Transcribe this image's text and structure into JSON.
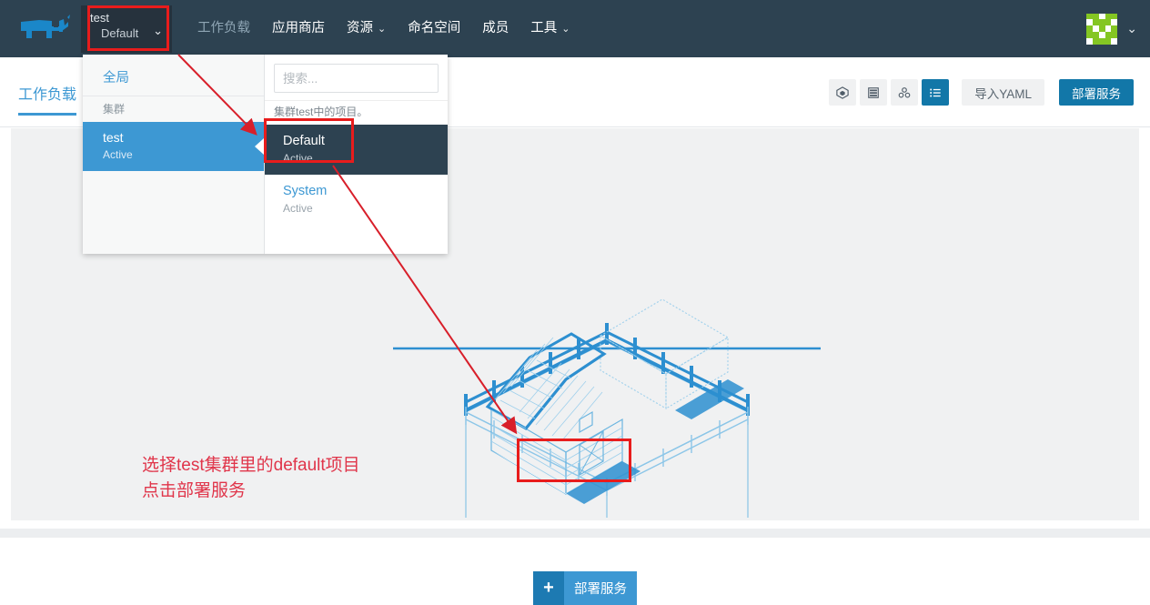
{
  "topnav": {
    "logo_icon": "rancher-bull-logo",
    "cluster_selector": {
      "cluster": "test",
      "project": "Default",
      "caret_icon": "chevron-down-icon"
    },
    "links": [
      {
        "label": "工作负载",
        "active": true,
        "caret": ""
      },
      {
        "label": "应用商店",
        "active": false,
        "caret": ""
      },
      {
        "label": "资源",
        "active": false,
        "caret": "⌄"
      },
      {
        "label": "命名空间",
        "active": false,
        "caret": ""
      },
      {
        "label": "成员",
        "active": false,
        "caret": ""
      },
      {
        "label": "工具",
        "active": false,
        "caret": "⌄"
      }
    ],
    "avatar_icon": "user-identicon-avatar",
    "avatar_caret_icon": "chevron-down-icon"
  },
  "subbar": {
    "tab_label": "工作负载",
    "view_icons": [
      {
        "name": "cube-view-icon",
        "active": false
      },
      {
        "name": "server-view-icon",
        "active": false
      },
      {
        "name": "cluster-view-icon",
        "active": false
      },
      {
        "name": "list-view-icon",
        "active": true
      }
    ],
    "import_yaml_label": "导入YAML",
    "deploy_label": "部署服务"
  },
  "dropdown": {
    "global_label": "全局",
    "cluster_section_label": "集群",
    "clusters": [
      {
        "name": "test",
        "state": "Active",
        "selected": true
      }
    ],
    "search_placeholder": "搜索...",
    "search_value": "",
    "projects_caption": "集群test中的项目。",
    "projects": [
      {
        "name": "Default",
        "state": "Active",
        "selected": true
      },
      {
        "name": "System",
        "state": "Active",
        "selected": false
      }
    ]
  },
  "content": {
    "empty_illustration": "isometric-barn-farm-illustration",
    "deploy_button": {
      "plus_icon": "plus-icon",
      "label": "部署服务"
    }
  },
  "annotations": {
    "line1": "选择test集群里的default项目",
    "line2": "点击部署服务",
    "color": "#e0354a",
    "highlight_color": "#e81c1c"
  }
}
